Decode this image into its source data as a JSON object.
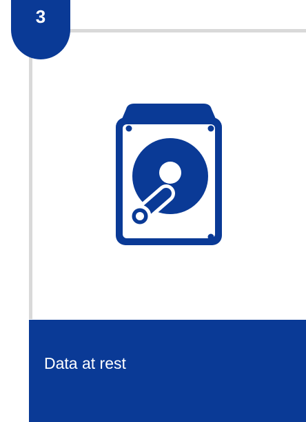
{
  "step": {
    "number": "3"
  },
  "card": {
    "icon": "hard-drive-icon",
    "label": "Data at rest"
  },
  "colors": {
    "accent": "#0a3a96",
    "frame": "#d9d9d9",
    "background": "#ffffff",
    "text_on_accent": "#ffffff"
  }
}
